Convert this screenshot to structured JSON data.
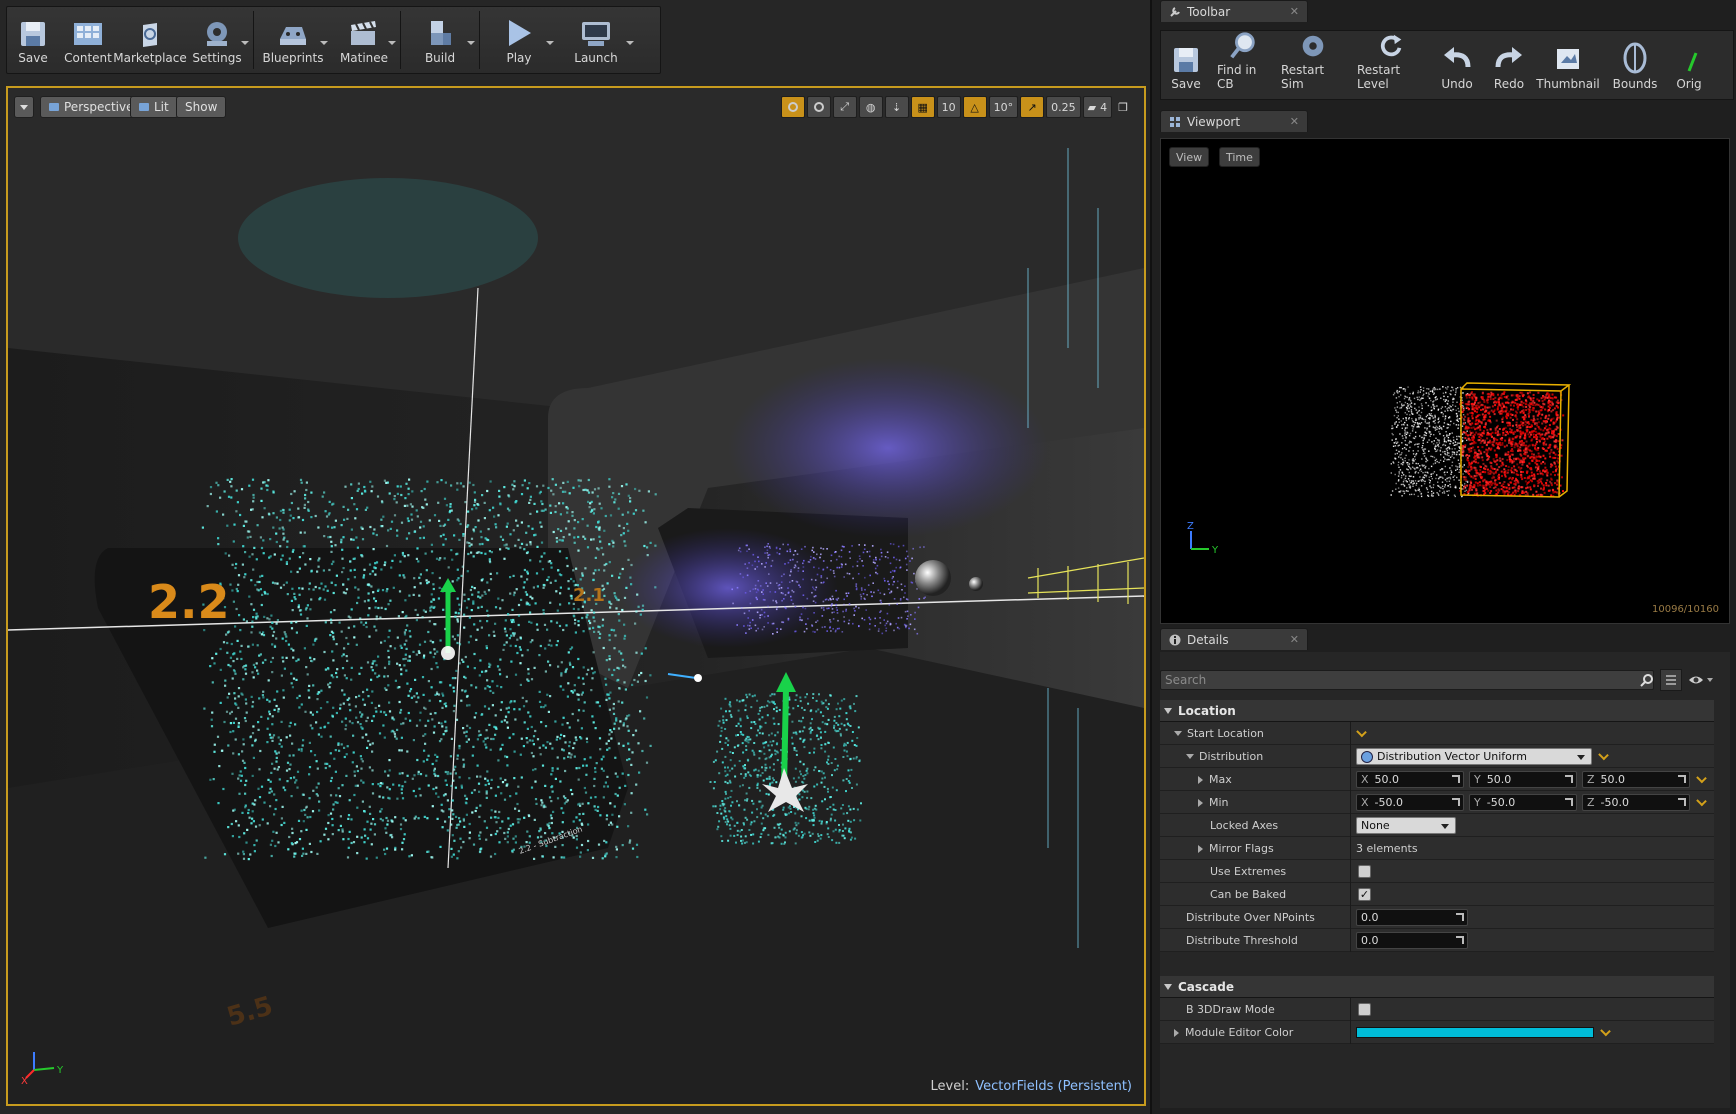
{
  "main_toolbar": {
    "buttons": [
      {
        "label": "Save",
        "icon": "save-icon"
      },
      {
        "label": "Content",
        "icon": "content-icon"
      },
      {
        "label": "Marketplace",
        "icon": "marketplace-icon"
      },
      {
        "label": "Settings",
        "icon": "settings-icon"
      },
      {
        "label": "Blueprints",
        "icon": "blueprints-icon"
      },
      {
        "label": "Matinee",
        "icon": "matinee-icon"
      },
      {
        "label": "Build",
        "icon": "build-icon"
      },
      {
        "label": "Play",
        "icon": "play-icon"
      },
      {
        "label": "Launch",
        "icon": "launch-icon"
      }
    ]
  },
  "viewport": {
    "perspective_label": "Perspective",
    "lit_label": "Lit",
    "show_label": "Show",
    "snap": {
      "grid": "10",
      "rotation": "10°",
      "scale": "0.25",
      "camera_speed": "4"
    },
    "level_prefix": "Level:",
    "level_name": "VectorFields (Persistent)",
    "scene_signs": {
      "big": "2.2",
      "mid": "2.1",
      "plate": "2.2 - Subtraction",
      "floor": "5.5"
    },
    "axis_labels": {
      "x": "X",
      "y": "Y"
    }
  },
  "toolbar_tab": {
    "title": "Toolbar"
  },
  "cascade_toolbar": {
    "buttons": [
      {
        "label": "Save",
        "icon": "save-icon"
      },
      {
        "label": "Find in CB",
        "icon": "find-in-cb-icon"
      },
      {
        "label": "Restart Sim",
        "icon": "restart-sim-icon"
      },
      {
        "label": "Restart Level",
        "icon": "restart-level-icon"
      },
      {
        "label": "Undo",
        "icon": "undo-icon"
      },
      {
        "label": "Redo",
        "icon": "redo-icon"
      },
      {
        "label": "Thumbnail",
        "icon": "thumbnail-icon"
      },
      {
        "label": "Bounds",
        "icon": "bounds-icon"
      },
      {
        "label": "Orig",
        "icon": "origin-icon"
      }
    ]
  },
  "viewport_tab": {
    "title": "Viewport"
  },
  "preview": {
    "view_label": "View",
    "time_label": "Time",
    "counter": "10096/10160",
    "axis_y": "Y",
    "axis_z": "Z"
  },
  "details_tab": {
    "title": "Details"
  },
  "details": {
    "search_placeholder": "Search",
    "location": {
      "title": "Location",
      "start_location": "Start Location",
      "distribution_label": "Distribution",
      "distribution_value": "Distribution Vector Uniform",
      "max_label": "Max",
      "max": {
        "x": "50.0",
        "y": "50.0",
        "z": "50.0"
      },
      "min_label": "Min",
      "min": {
        "x": "-50.0",
        "y": "-50.0",
        "z": "-50.0"
      },
      "locked_axes_label": "Locked Axes",
      "locked_axes_value": "None",
      "mirror_flags_label": "Mirror Flags",
      "mirror_flags_value": "3 elements",
      "use_extremes_label": "Use Extremes",
      "use_extremes": false,
      "can_be_baked_label": "Can be Baked",
      "can_be_baked": true,
      "distribute_npoints_label": "Distribute Over NPoints",
      "distribute_npoints": "0.0",
      "distribute_threshold_label": "Distribute Threshold",
      "distribute_threshold": "0.0"
    },
    "cascade": {
      "title": "Cascade",
      "draw_mode_label": "B 3DDraw Mode",
      "draw_mode": false,
      "module_color_label": "Module Editor Color",
      "module_color": "#00bcd8"
    },
    "axis_x": "X",
    "axis_y": "Y",
    "axis_z": "Z"
  }
}
